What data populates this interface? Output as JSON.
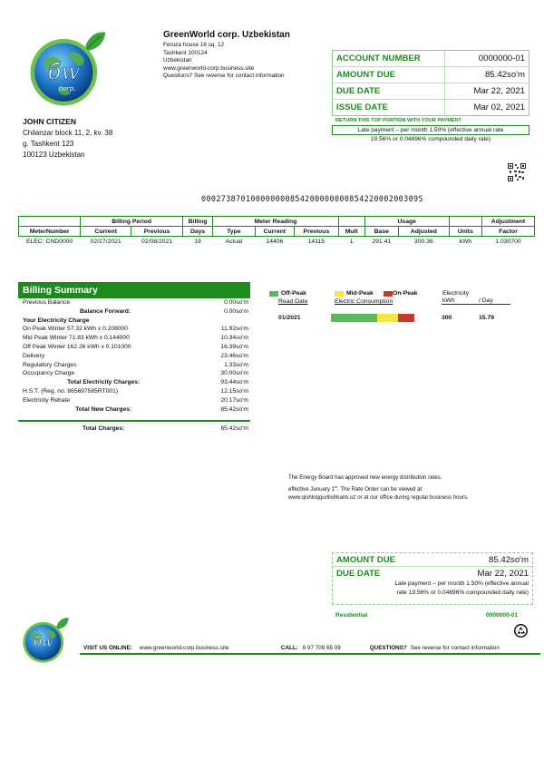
{
  "company": {
    "name": "GreenWorld corp. Uzbekistan",
    "address_lines": [
      "Feruza house 16 sq. 12",
      "Tashkent 100124",
      "Uzbekistan",
      "www.greenworld-corp.business.site",
      "Questions? See reverse for contact information"
    ],
    "logo_icon": "globe-leaf-logo",
    "logo_text": "corp."
  },
  "customer": {
    "name": "JOHN CITIZEN",
    "address_lines": [
      "Chilanzar block 11, 2, kv. 38",
      "g. Tashkent 123",
      "100123 Uzbekistan"
    ]
  },
  "account_box": {
    "rows": [
      {
        "label": "ACCOUNT NUMBER",
        "value": "0000000-01"
      },
      {
        "label": "AMOUNT DUE",
        "value": "85.42so'm"
      },
      {
        "label": "DUE DATE",
        "value": "Mar 22, 2021"
      },
      {
        "label": "ISSUE DATE",
        "value": "Mar 02, 2021"
      }
    ],
    "return_note": "RETURN THIS TOP PORTION WITH YOUR PAYMENT",
    "late_line1": "Late payment – per month 1.50% (effective annual rate",
    "late_line2": "19.56% or 0.04896% compounded daily rate)"
  },
  "qr_icon": "qr-code-icon",
  "barcode_number": "00027387010000000085420000000085422000200309S",
  "meter_table": {
    "group_headers": [
      "",
      "Billing Period",
      "Billing",
      "Meter Reading",
      "",
      "Usage",
      "",
      "Adjustment"
    ],
    "columns": [
      "MeterNumber",
      "Current",
      "Previous",
      "Days",
      "Type",
      "Current",
      "Previous",
      "Mult",
      "Base",
      "Adjusted",
      "Units",
      "Factor"
    ],
    "rows": [
      [
        "ELEC: CND0000",
        "02/27/2021",
        "02/08/2021",
        "19",
        "Actual",
        "14406",
        "14115",
        "1",
        "291.41",
        "300.36",
        "kWh",
        "1.030700"
      ]
    ]
  },
  "billing_summary": {
    "title": "Billing Summary",
    "rows": [
      {
        "label": "Previous Balance",
        "value": "0.00so'm",
        "style": "plain"
      },
      {
        "label": "Balance Forward:",
        "value": "0.00so'm",
        "style": "center"
      },
      {
        "label": "Your Electricity Charge",
        "value": "",
        "style": "bold"
      },
      {
        "label": "On Peak Winter 57.32 kWh x 0.208000",
        "value": "11.92so'm",
        "style": "plain"
      },
      {
        "label": "Mid Peak Winter 71.83 kWh x 0.144000",
        "value": "10.34so'm",
        "style": "plain"
      },
      {
        "label": "Off Peak Winter 162.26 kWh x 0.101000",
        "value": "16.39so'm",
        "style": "plain"
      },
      {
        "label": "Delivery",
        "value": "23.46so'm",
        "style": "plain"
      },
      {
        "label": "Regulatory Charges",
        "value": "1.33so'm",
        "style": "plain"
      },
      {
        "label": "Occupancy Charge",
        "value": "30.00so'm",
        "style": "plain"
      },
      {
        "label": "Total Electricity Charges:",
        "value": "93.44so'm",
        "style": "center"
      },
      {
        "label": "H.S.T. (Reg. no. 865697585RT001)",
        "value": "12.15so'm",
        "style": "plain"
      },
      {
        "label": "Electricity Rebate",
        "value": "20.17so'm",
        "style": "plain"
      },
      {
        "label": "Total New Charges:",
        "value": "85.42so'm",
        "style": "center"
      }
    ],
    "total_label": "Total Charges:",
    "total_value": "85.42so'm"
  },
  "consumption": {
    "legend": [
      {
        "label": "Off-Peak",
        "color": "#5cb85c"
      },
      {
        "label": "Mid-Peak",
        "color": "#f5e642"
      },
      {
        "label": "On-Peak",
        "color": "#c9372c"
      }
    ],
    "headers": {
      "read_date": "Read Date",
      "electric_consumption": "Electric Consumption",
      "electricity": "Electricity",
      "kwh": "kWh",
      "per_day": "/ Day"
    },
    "rows": [
      {
        "read_date": "01/2021",
        "off_peak": 162.26,
        "mid_peak": 71.83,
        "on_peak": 57.32,
        "kwh": "300",
        "per_day": "15.79"
      }
    ]
  },
  "notice": {
    "line1": "The Energy Board has approved new energy distribution rates,",
    "line2_pre": "effective January 1",
    "line2_sup": "st",
    "line2_post": ". The Rate Order can be viewed at",
    "line3": "www.qishloqqurilishbank.uz or at our office during regular business hours."
  },
  "bottom_box": {
    "amount_label": "AMOUNT DUE",
    "amount_value": "85.42so'm",
    "due_label": "DUE DATE",
    "due_value": "Mar 22, 2021",
    "late_line1": "Late payment – per month 1.50% (effective annual",
    "late_line2": "rate 19.56% or 0.04896% compounded daily rate)",
    "account_type": "Residential",
    "account_number": "0000000-01"
  },
  "footer": {
    "visit_label": "VISIT US ONLINE:",
    "visit_url": "www.greenworld-corp.business.site",
    "call_label": "CALL:",
    "call_number": "8 97 709 65 09",
    "questions_label": "QUESTIONS?",
    "questions_text": "See reverse for contact information",
    "recycle_icon": "recycle-icon"
  }
}
